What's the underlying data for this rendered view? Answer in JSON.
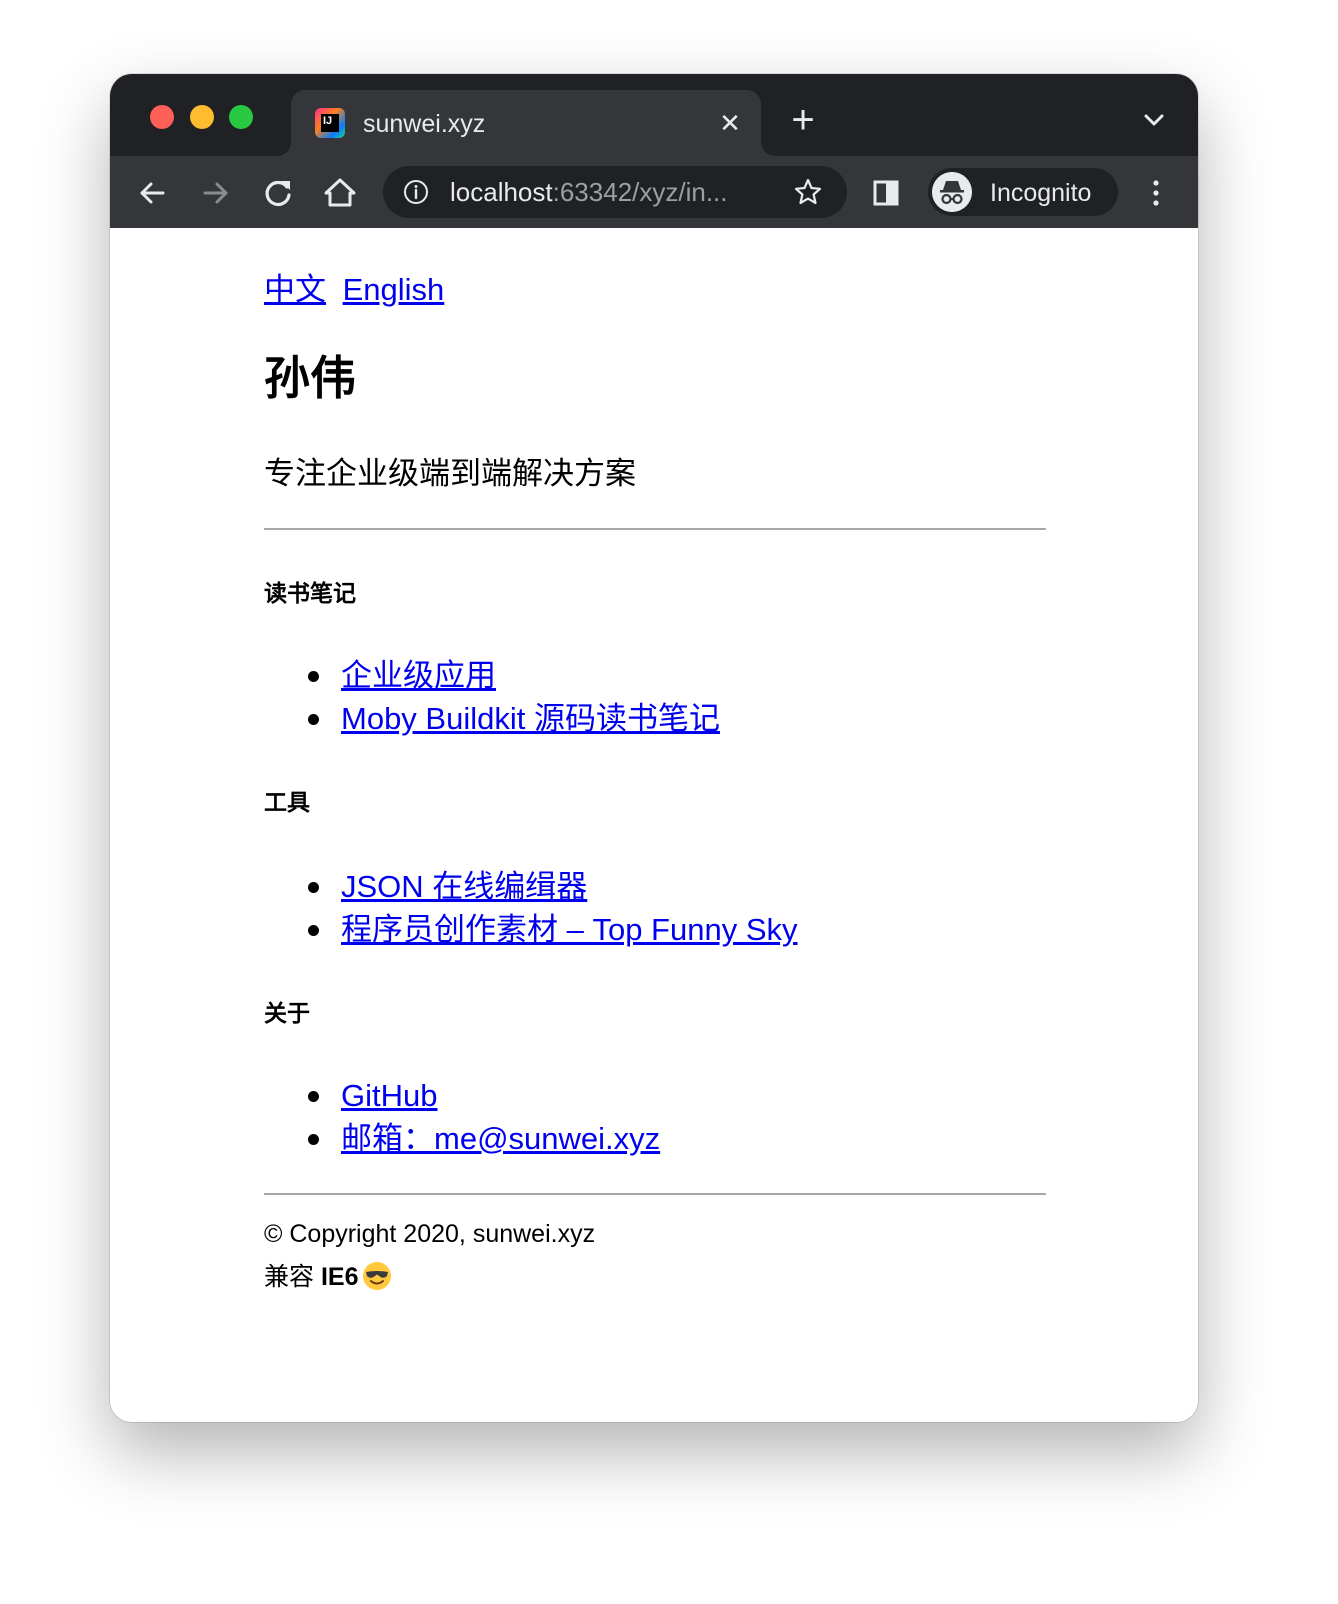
{
  "browser": {
    "tab": {
      "title": "sunwei.xyz",
      "close_glyph": "✕",
      "favicon": "jetbrains-icon"
    },
    "new_tab_glyph": "+",
    "address": {
      "host": "localhost",
      "rest": ":63342/xyz/in..."
    },
    "incognito_label": "Incognito",
    "traffic_lights": {
      "close": "#fe5f57",
      "minimize": "#febc2e",
      "zoom": "#28c840"
    }
  },
  "page": {
    "lang_links": [
      "中文",
      "English"
    ],
    "title": "孙伟",
    "tagline": "专注企业级端到端解决方案",
    "sections": [
      {
        "title": "读书笔记",
        "links": [
          "企业级应用",
          "Moby Buildkit 源码读书笔记"
        ]
      },
      {
        "title": "工具",
        "links": [
          "JSON 在线编缉器",
          "程序员创作素材 – Top Funny Sky"
        ]
      },
      {
        "title": "关于",
        "links": [
          "GitHub",
          "邮箱：me@sunwei.xyz"
        ]
      }
    ],
    "footer": {
      "copyright": "© Copyright 2020, sunwei.xyz",
      "compat_prefix": "兼容 ",
      "compat_bold": "IE6",
      "emoji": "smiling-face-with-sunglasses-icon"
    }
  },
  "colors": {
    "link": "#0000ee",
    "chrome_dark": "#202124",
    "chrome_toolbar": "#35363a"
  }
}
